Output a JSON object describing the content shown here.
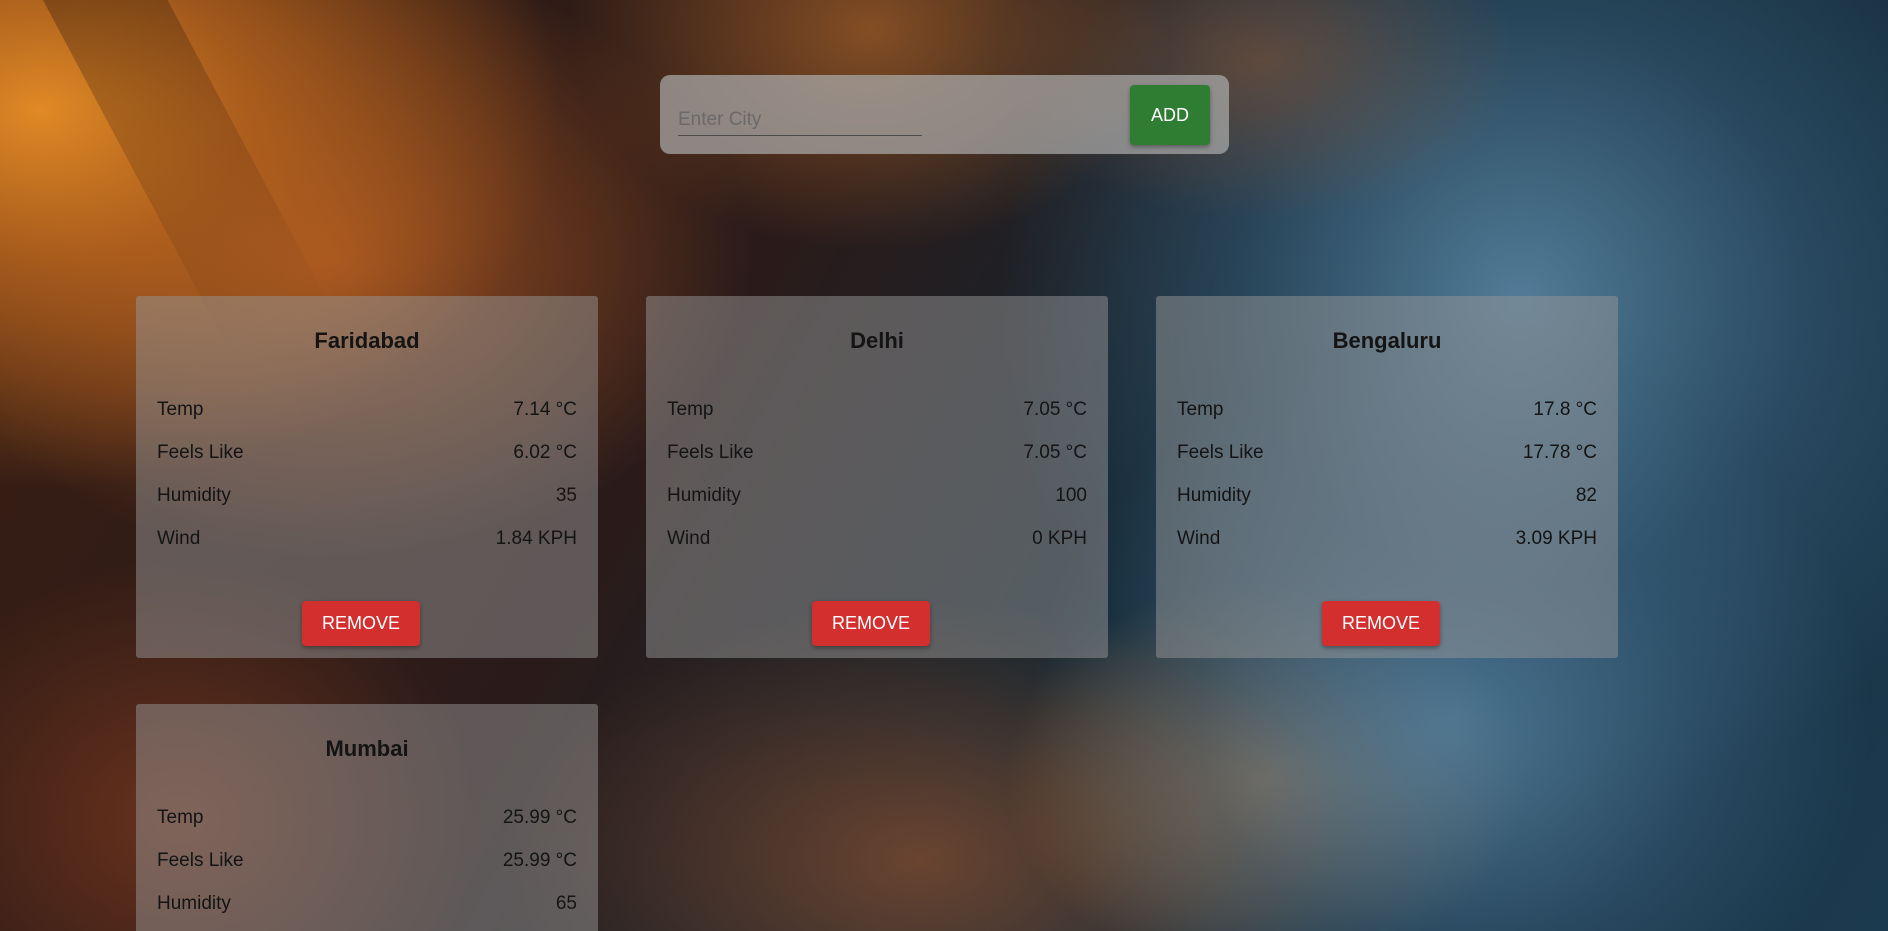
{
  "search": {
    "placeholder": "Enter City",
    "value": "",
    "add_label": "ADD"
  },
  "cards": [
    {
      "city": "Faridabad",
      "temp_label": "Temp",
      "temp": "7.14 °C",
      "feels_label": "Feels Like",
      "feels": "6.02 °C",
      "humidity_label": "Humidity",
      "humidity": "35",
      "wind_label": "Wind",
      "wind": "1.84 KPH",
      "remove_label": "REMOVE"
    },
    {
      "city": "Delhi",
      "temp_label": "Temp",
      "temp": "7.05 °C",
      "feels_label": "Feels Like",
      "feels": "7.05 °C",
      "humidity_label": "Humidity",
      "humidity": "100",
      "wind_label": "Wind",
      "wind": "0 KPH",
      "remove_label": "REMOVE"
    },
    {
      "city": "Bengaluru",
      "temp_label": "Temp",
      "temp": "17.8 °C",
      "feels_label": "Feels Like",
      "feels": "17.78 °C",
      "humidity_label": "Humidity",
      "humidity": "82",
      "wind_label": "Wind",
      "wind": "3.09 KPH",
      "remove_label": "REMOVE"
    },
    {
      "city": "Mumbai",
      "temp_label": "Temp",
      "temp": "25.99 °C",
      "feels_label": "Feels Like",
      "feels": "25.99 °C",
      "humidity_label": "Humidity",
      "humidity": "65"
    }
  ],
  "colors": {
    "add_button": "#2e7d32",
    "remove_button": "#d32f2f"
  }
}
